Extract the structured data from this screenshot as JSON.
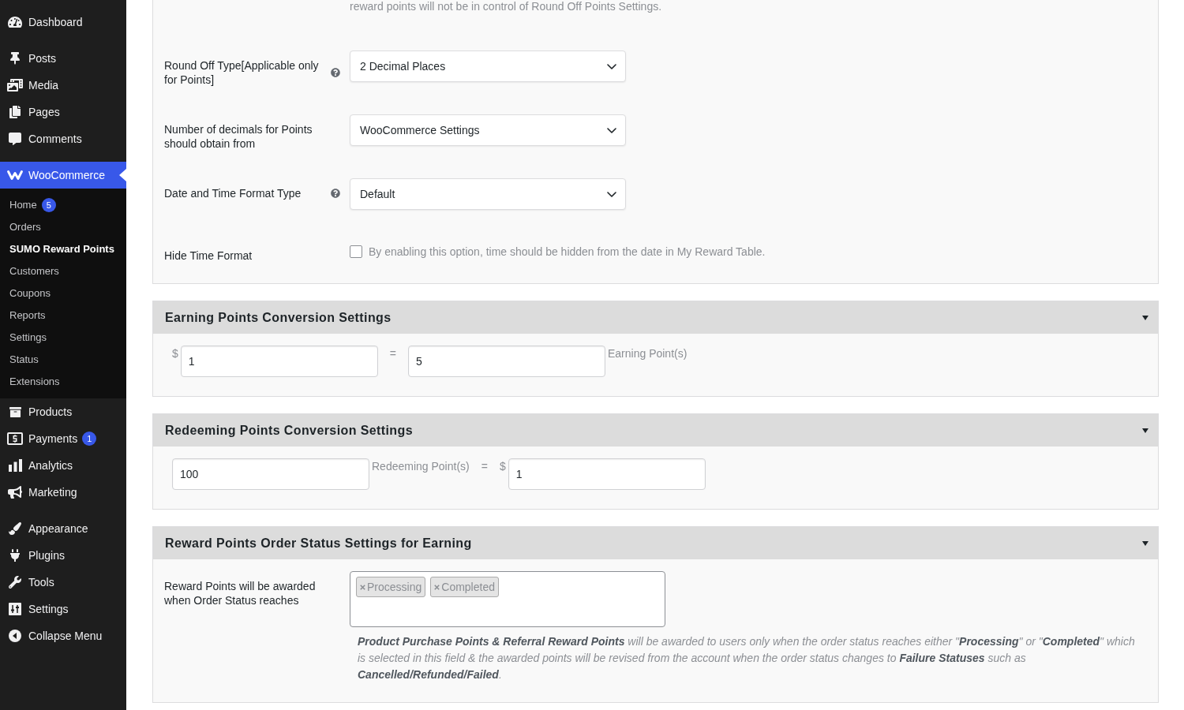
{
  "sidebar": {
    "groups": [
      {
        "items": [
          {
            "label": "Dashboard",
            "selected": false
          }
        ]
      },
      {
        "items": [
          {
            "label": "Posts",
            "selected": false
          },
          {
            "label": "Media",
            "selected": false
          },
          {
            "label": "Pages",
            "selected": false
          },
          {
            "label": "Comments",
            "selected": false
          }
        ]
      },
      {
        "items": [
          {
            "label": "WooCommerce",
            "selected": true,
            "children": [
              {
                "label": "Home",
                "selected": false,
                "badge": "5"
              },
              {
                "label": "Orders",
                "selected": false
              },
              {
                "label": "SUMO Reward Points",
                "selected": true
              },
              {
                "label": "Customers",
                "selected": false
              },
              {
                "label": "Coupons",
                "selected": false
              },
              {
                "label": "Reports",
                "selected": false
              },
              {
                "label": "Settings",
                "selected": false
              },
              {
                "label": "Status",
                "selected": false
              },
              {
                "label": "Extensions",
                "selected": false
              }
            ]
          },
          {
            "label": "Products",
            "selected": false
          },
          {
            "label": "Payments",
            "selected": false,
            "badge": "1"
          },
          {
            "label": "Analytics",
            "selected": false
          },
          {
            "label": "Marketing",
            "selected": false
          }
        ]
      },
      {
        "items": [
          {
            "label": "Appearance",
            "selected": false
          },
          {
            "label": "Plugins",
            "selected": false
          },
          {
            "label": "Tools",
            "selected": false
          },
          {
            "label": "Settings",
            "selected": false
          },
          {
            "label": "Collapse Menu",
            "selected": false
          }
        ]
      }
    ]
  },
  "general_settings": {
    "description": "reward points will not be in control of Round Off Points Settings.",
    "rows": [
      {
        "kind": "select",
        "label": "Round Off Type[Applicable only for Points]",
        "help": true,
        "value": "2 Decimal Places"
      },
      {
        "kind": "select",
        "label": "Number of decimals for Points should obtain from",
        "help": false,
        "value": "WooCommerce Settings"
      },
      {
        "kind": "select",
        "label": "Date and Time Format Type",
        "help": true,
        "value": "Default"
      },
      {
        "kind": "checkbox",
        "label": "Hide Time Format",
        "help": false,
        "checked": false,
        "description": "By enabling this option, time should be hidden from the date in My Reward Table."
      }
    ]
  },
  "sections": [
    {
      "kind": "conversion",
      "title": "Earning Points Conversion Settings",
      "expanded": true,
      "items": [
        {
          "kind": "affix",
          "text": "$"
        },
        {
          "kind": "input",
          "value": "1"
        },
        {
          "kind": "operator",
          "text": "="
        },
        {
          "kind": "input",
          "value": "5"
        },
        {
          "kind": "affix",
          "text": "Earning Point(s)"
        }
      ]
    },
    {
      "kind": "conversion",
      "title": "Redeeming Points Conversion Settings",
      "expanded": true,
      "items": [
        {
          "kind": "input",
          "value": "100"
        },
        {
          "kind": "affix",
          "text": "Redeeming Point(s)"
        },
        {
          "kind": "operator",
          "text": "="
        },
        {
          "kind": "affix",
          "text": "$"
        },
        {
          "kind": "input",
          "value": "1"
        }
      ]
    },
    {
      "kind": "order_status",
      "title": "Reward Points Order Status Settings for Earning",
      "expanded": true,
      "label": "Reward Points will be awarded when Order Status reaches",
      "tags": [
        {
          "label": "Processing"
        },
        {
          "label": "Completed"
        }
      ],
      "description": "**Product Purchase Points & Referral Reward Points** will be awarded to users only when the order status reaches either \"**Processing**\" or \"**Completed**\" which is selected in this field & the awarded points will be revised from the account when the order status changes to **Failure Statuses** such as **Cancelled/Refunded/Failed**."
    }
  ]
}
